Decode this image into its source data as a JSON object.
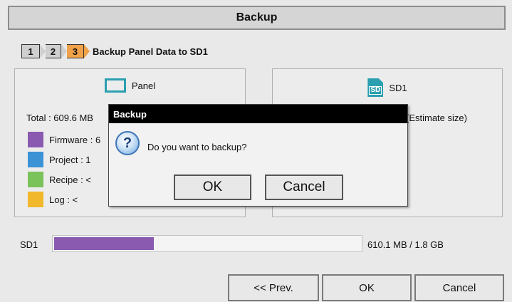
{
  "window": {
    "title": "Backup"
  },
  "wizard": {
    "steps": [
      "1",
      "2",
      "3"
    ],
    "active_step_label": "Backup Panel Data to SD1"
  },
  "source": {
    "title": "Panel",
    "total": "Total : 609.6 MB",
    "legend": [
      {
        "label": "Firmware : 6",
        "color": "#8a5ab0"
      },
      {
        "label": "Project   : 1",
        "color": "#3b93d6"
      },
      {
        "label": "Recipe    : <",
        "color": "#7ac25a"
      },
      {
        "label": "Log         : <",
        "color": "#f0b82a"
      }
    ]
  },
  "destination": {
    "title": "SD1",
    "icon_text": "SD",
    "estimate": "(Estimate size)"
  },
  "storage": {
    "label": "SD1",
    "usage_text": "610.1 MB / 1.8 GB",
    "used_fraction": 0.331
  },
  "nav": {
    "prev": "<< Prev.",
    "ok": "OK",
    "cancel": "Cancel"
  },
  "dialog": {
    "title": "Backup",
    "icon": "?",
    "message": "Do you want to backup?",
    "ok": "OK",
    "cancel": "Cancel"
  }
}
